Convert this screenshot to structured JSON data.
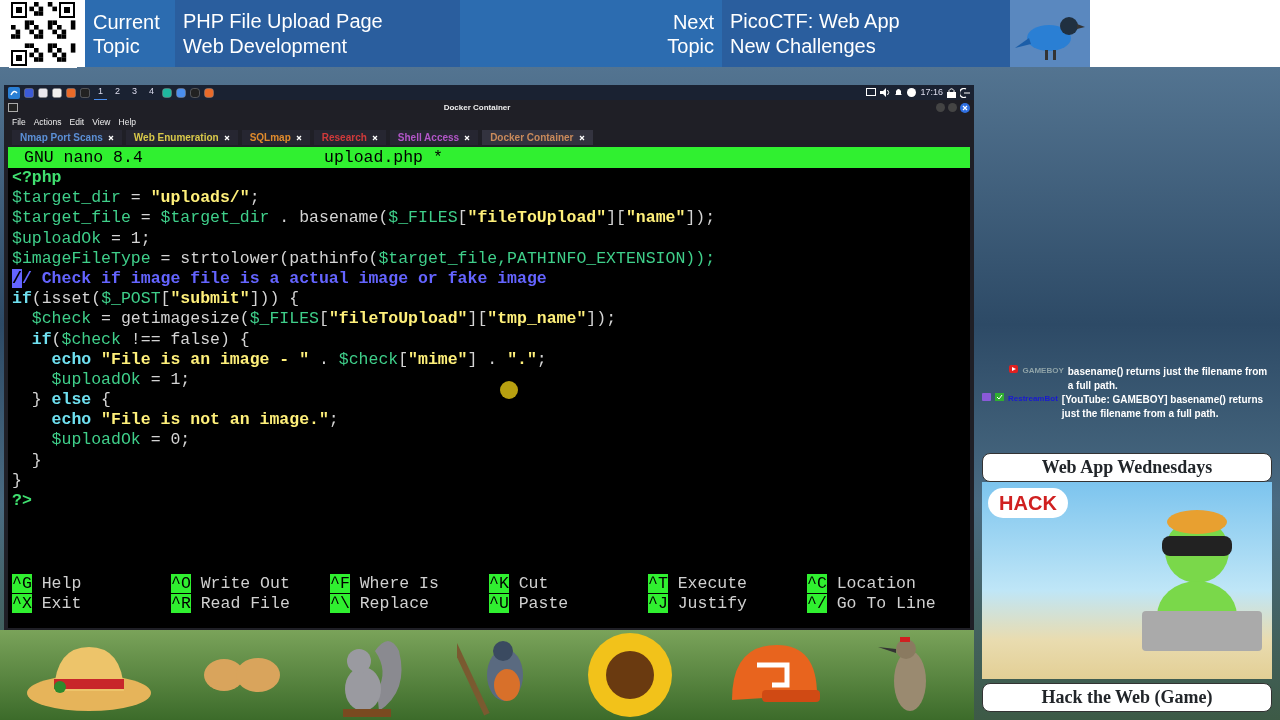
{
  "header": {
    "current_label": "Current Topic",
    "current_lines": [
      "PHP File Upload Page",
      "Web Development"
    ],
    "next_label": "Next Topic",
    "next_lines": [
      "PicoCTF: Web App",
      "New Challenges"
    ]
  },
  "taskbar": {
    "workspaces": [
      {
        "label": "1",
        "selected": true
      },
      {
        "label": "2",
        "selected": false
      },
      {
        "label": "3",
        "selected": false
      },
      {
        "label": "4",
        "selected": false
      }
    ],
    "clock": "17:16"
  },
  "window": {
    "title": "Docker Container",
    "menu": [
      "File",
      "Actions",
      "Edit",
      "View",
      "Help"
    ],
    "tabs": [
      {
        "label": "Nmap Port Scans",
        "color": "#5b8fd6",
        "selected": false
      },
      {
        "label": "Web Enumeration",
        "color": "#d9c94a",
        "selected": false
      },
      {
        "label": "SQLmap",
        "color": "#e08a2c",
        "selected": false
      },
      {
        "label": "Research",
        "color": "#d03a3a",
        "selected": false
      },
      {
        "label": "Shell Access",
        "color": "#b256c8",
        "selected": false
      },
      {
        "label": "Docker Container",
        "color": "#c98a5a",
        "selected": true
      }
    ]
  },
  "nano": {
    "version": "GNU nano 8.4",
    "filename": "upload.php *",
    "lines": [
      [
        {
          "kind": "tag",
          "text": "<?php"
        }
      ],
      [
        {
          "kind": "var",
          "text": "$target_dir"
        },
        {
          "kind": "plain",
          "text": " = "
        },
        {
          "kind": "str",
          "text": "\"uploads/\""
        },
        {
          "kind": "plain",
          "text": ";"
        }
      ],
      [
        {
          "kind": "var",
          "text": "$target_file"
        },
        {
          "kind": "plain",
          "text": " = "
        },
        {
          "kind": "var",
          "text": "$target_dir"
        },
        {
          "kind": "plain",
          "text": " . basename("
        },
        {
          "kind": "var",
          "text": "$_FILES"
        },
        {
          "kind": "plain",
          "text": "["
        },
        {
          "kind": "str",
          "text": "\"fileToUpload\""
        },
        {
          "kind": "plain",
          "text": "]["
        },
        {
          "kind": "str",
          "text": "\"name\""
        },
        {
          "kind": "plain",
          "text": "]);"
        }
      ],
      [
        {
          "kind": "var",
          "text": "$uploadOk"
        },
        {
          "kind": "plain",
          "text": " = 1;"
        }
      ],
      [
        {
          "kind": "var",
          "text": "$imageFileType"
        },
        {
          "kind": "plain",
          "text": " = strtolower(pathinfo("
        },
        {
          "kind": "var",
          "text": "$target_file,PATHINFO_EXTENSION));"
        }
      ],
      [
        {
          "kind": "cursor",
          "text": "/"
        },
        {
          "kind": "comment",
          "text": "/ Check if image file is a actual image or fake image"
        }
      ],
      [
        {
          "kind": "kw",
          "text": "if"
        },
        {
          "kind": "plain",
          "text": "(isset("
        },
        {
          "kind": "var",
          "text": "$_POST"
        },
        {
          "kind": "plain",
          "text": "["
        },
        {
          "kind": "str",
          "text": "\"submit\""
        },
        {
          "kind": "plain",
          "text": "])) {"
        }
      ],
      [
        {
          "kind": "var",
          "text": "  $check"
        },
        {
          "kind": "plain",
          "text": " = getimagesize("
        },
        {
          "kind": "var",
          "text": "$_FILES"
        },
        {
          "kind": "plain",
          "text": "["
        },
        {
          "kind": "str",
          "text": "\"fileToUpload\""
        },
        {
          "kind": "plain",
          "text": "]["
        },
        {
          "kind": "str",
          "text": "\"tmp_name\""
        },
        {
          "kind": "plain",
          "text": "]);"
        }
      ],
      [
        {
          "kind": "kw",
          "text": "  if"
        },
        {
          "kind": "plain",
          "text": "("
        },
        {
          "kind": "var",
          "text": "$check"
        },
        {
          "kind": "plain",
          "text": " !== false) {"
        }
      ],
      [
        {
          "kind": "kw",
          "text": "    echo"
        },
        {
          "kind": "str",
          "text": " \"File is an image - \""
        },
        {
          "kind": "plain",
          "text": " . "
        },
        {
          "kind": "var",
          "text": "$check"
        },
        {
          "kind": "plain",
          "text": "["
        },
        {
          "kind": "str",
          "text": "\"mime\""
        },
        {
          "kind": "plain",
          "text": "] . "
        },
        {
          "kind": "str",
          "text": "\".\""
        },
        {
          "kind": "plain",
          "text": ";"
        }
      ],
      [
        {
          "kind": "var",
          "text": "    $uploadOk"
        },
        {
          "kind": "plain",
          "text": " = 1;"
        }
      ],
      [
        {
          "kind": "plain",
          "text": "  } "
        },
        {
          "kind": "kw",
          "text": "else"
        },
        {
          "kind": "plain",
          "text": " {"
        }
      ],
      [
        {
          "kind": "kw",
          "text": "    echo"
        },
        {
          "kind": "str",
          "text": " \"File is not an image.\""
        },
        {
          "kind": "plain",
          "text": ";"
        }
      ],
      [
        {
          "kind": "var",
          "text": "    $uploadOk"
        },
        {
          "kind": "plain",
          "text": " = 0;"
        }
      ],
      [
        {
          "kind": "plain",
          "text": "  }"
        }
      ],
      [
        {
          "kind": "plain",
          "text": "}"
        }
      ],
      [
        {
          "kind": "tag",
          "text": "?>"
        }
      ]
    ],
    "shortcuts": [
      [
        {
          "key": "^G",
          "label": "Help"
        },
        {
          "key": "^X",
          "label": "Exit"
        }
      ],
      [
        {
          "key": "^O",
          "label": "Write Out"
        },
        {
          "key": "^R",
          "label": "Read File"
        }
      ],
      [
        {
          "key": "^F",
          "label": "Where Is"
        },
        {
          "key": "^\\",
          "label": "Replace"
        }
      ],
      [
        {
          "key": "^K",
          "label": "Cut"
        },
        {
          "key": "^U",
          "label": "Paste"
        }
      ],
      [
        {
          "key": "^T",
          "label": "Execute"
        },
        {
          "key": "^J",
          "label": "Justify"
        }
      ],
      [
        {
          "key": "^C",
          "label": "Location"
        },
        {
          "key": "^/",
          "label": "Go To Line"
        }
      ]
    ]
  },
  "chat": [
    {
      "kind": "youtube",
      "user": "GAMEBOY",
      "color": "#8fa3a8",
      "text": "basename() returns just the filename from a full path."
    },
    {
      "kind": "twitch",
      "user": "RestreamBot",
      "color": "#1a1ad0",
      "text": "[YouTube: GAMEBOY] basename() returns just the filename from a full path."
    }
  ],
  "promo": {
    "title": "Web App Wednesdays",
    "bubble": "HACK",
    "footer": "Hack the Web (Game)"
  }
}
